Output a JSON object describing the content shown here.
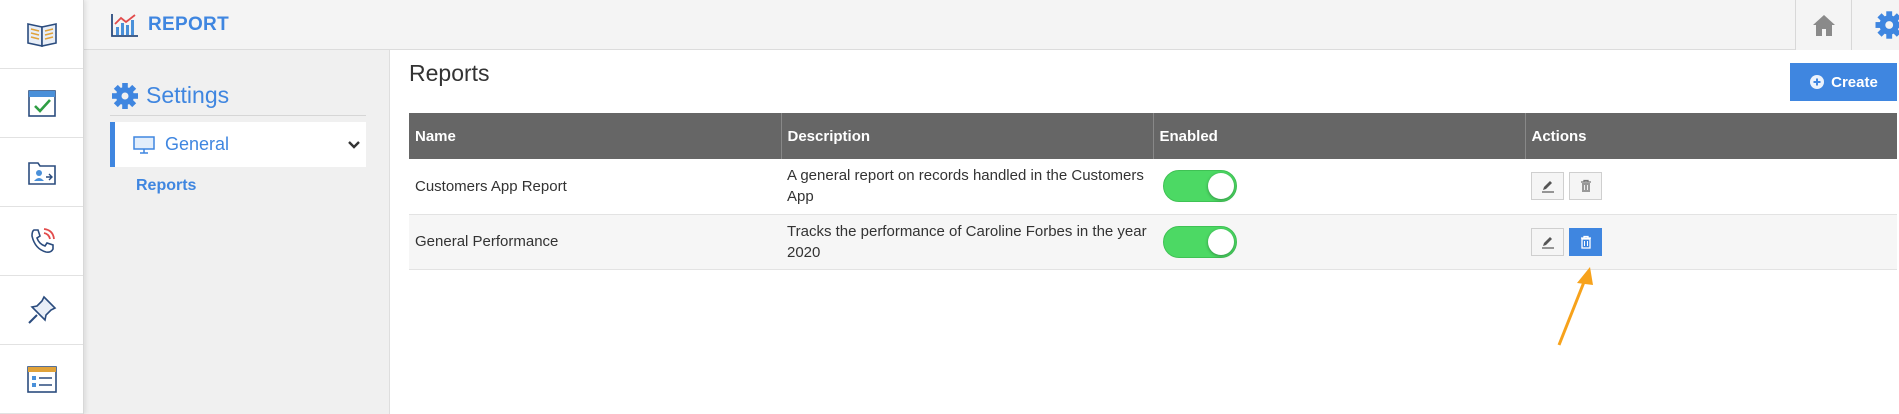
{
  "app": {
    "title": "REPORT"
  },
  "colors": {
    "accent": "#3f86e0",
    "header_bg": "#666666",
    "toggle_on": "#4cd964",
    "annotation_arrow": "#f7a21b"
  },
  "rail": {
    "items": [
      {
        "icon": "book-icon"
      },
      {
        "icon": "calendar-check-icon"
      },
      {
        "icon": "folder-user-icon"
      },
      {
        "icon": "phone-icon"
      },
      {
        "icon": "pin-icon"
      },
      {
        "icon": "window-list-icon"
      }
    ]
  },
  "topbar": {
    "home_icon": "home-icon",
    "settings_icon": "gear-icon"
  },
  "sidebar": {
    "title": "Settings",
    "general_label": "General",
    "reports_label": "Reports"
  },
  "main": {
    "title": "Reports",
    "create_label": "Create",
    "columns": [
      "Name",
      "Description",
      "Enabled",
      "Actions"
    ],
    "rows": [
      {
        "name": "Customers App Report",
        "description": "A general report on records handled in the Customers App",
        "enabled": true
      },
      {
        "name": "General Performance",
        "description": "Tracks the performance of Caroline Forbes in the year 2020",
        "enabled": true
      }
    ]
  }
}
